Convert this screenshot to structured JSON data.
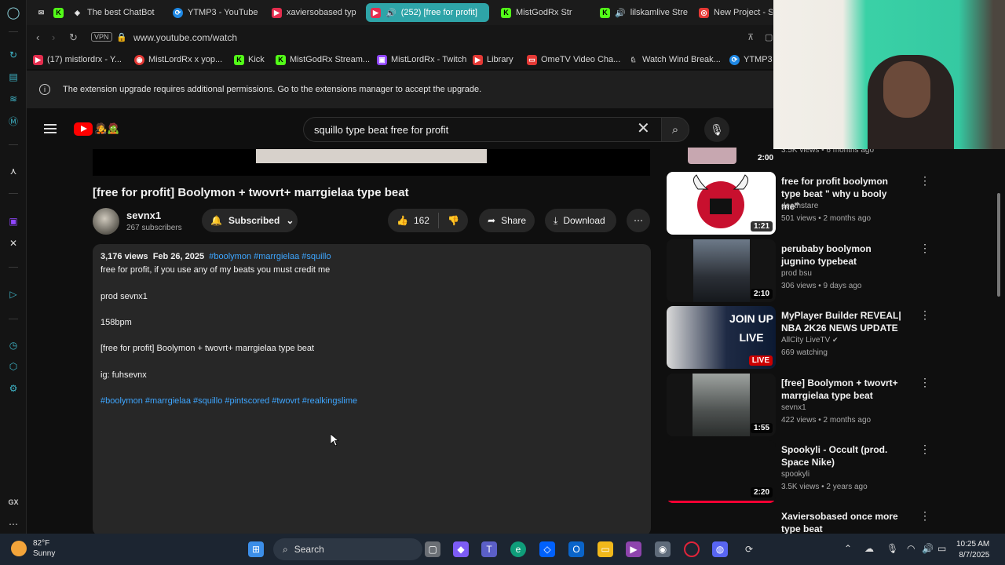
{
  "browser": {
    "tabs": [
      {
        "label": "The best ChatBot",
        "active": false
      },
      {
        "label": "YTMP3 - YouTube",
        "active": false
      },
      {
        "label": "xaviersobased typ",
        "active": false
      },
      {
        "label": "(252) [free for profit]",
        "active": true
      },
      {
        "label": "MistGodRx Str",
        "active": false
      },
      {
        "label": "lilskamlive Stre",
        "active": false
      },
      {
        "label": "New Project - S",
        "active": false
      }
    ],
    "vpn_label": "VPN",
    "url": "www.youtube.com/watch",
    "bookmarks": [
      "(17) mistlordrx - Y...",
      "MistLordRx x yop...",
      "Kick",
      "MistGodRx Stream...",
      "MistLordRx - Twitch",
      "Library",
      "OmeTV Video Cha...",
      "Watch Wind Break...",
      "YTMP3"
    ],
    "infobar": "The extension upgrade requires additional permissions. Go to the extensions manager to accept the upgrade."
  },
  "youtube": {
    "search_query": "squillo type beat free for profit",
    "video": {
      "title": "[free for profit] Boolymon + twovrt+ marrgielaa type beat",
      "channel": "sevnx1",
      "subscribers": "267 subscribers",
      "subscribe_label": "Subscribed",
      "likes": "162",
      "share_label": "Share",
      "download_label": "Download"
    },
    "description": {
      "views": "3,176 views",
      "date": "Feb 26, 2025",
      "tags": "#boolymon #marrgielaa #squillo",
      "lines": [
        "free for profit, if you use any of my beats you must credit me",
        "prod sevnx1",
        "158bpm",
        "[free for profit] Boolymon + twovrt+ marrgielaa type beat",
        "ig: fuhsevnx"
      ],
      "hashtags": "#boolymon #marrgielaa #squillo #pintscored #twovrt #realkingslime"
    },
    "recommendations": [
      {
        "title": "",
        "channel": "",
        "meta": "3.5K views • 6 months ago",
        "duration": "2:00"
      },
      {
        "title": "free for profit boolymon type beat \" why u booly me\"",
        "channel": "deathstare",
        "meta": "501 views • 2 months ago",
        "duration": "1:21"
      },
      {
        "title": "perubaby boolymon jugnino typebeat",
        "channel": "prod bsu",
        "meta": "306 views • 9 days ago",
        "duration": "2:10"
      },
      {
        "title": "MyPlayer Builder REVEAL| NBA 2K26 NEWS UPDATE",
        "channel": "AllCity LiveTV",
        "meta": "669 watching",
        "duration": "LIVE"
      },
      {
        "title": "[free] Boolymon + twovrt+ marrgielaa type beat",
        "channel": "sevnx1",
        "meta": "422 views • 2 months ago",
        "duration": "1:55"
      },
      {
        "title": "Spookyli - Occult (prod. Space Nike)",
        "channel": "spookyli",
        "meta": "3.5K views • 2 years ago",
        "duration": "2:20"
      },
      {
        "title": "Xaviersobased once more type beat",
        "channel": "",
        "meta": "",
        "duration": ""
      }
    ],
    "live_thumb_text": "JOIN UP LIVE"
  },
  "taskbar": {
    "weather_temp": "82°F",
    "weather_desc": "Sunny",
    "search_label": "Search",
    "time": "10:25 AM",
    "date": "8/7/2025"
  }
}
